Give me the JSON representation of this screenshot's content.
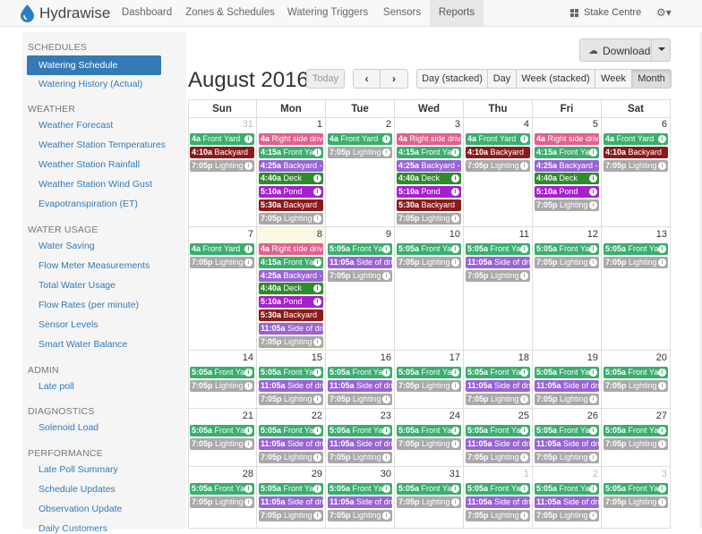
{
  "nav": {
    "brand": "Hydrawise",
    "items": [
      "Dashboard",
      "Zones & Schedules",
      "Watering Triggers",
      "Sensors",
      "Reports"
    ],
    "active": "Reports",
    "site": "Stake Centre",
    "settings_caret": "▾"
  },
  "sidebar": {
    "sections": [
      {
        "title": "SCHEDULES",
        "items": [
          "Watering Schedule",
          "Watering History (Actual)"
        ]
      },
      {
        "title": "WEATHER",
        "items": [
          "Weather Forecast",
          "Weather Station Temperatures",
          "Weather Station Rainfall",
          "Weather Station Wind Gust",
          "Evapotranspiration (ET)"
        ]
      },
      {
        "title": "WATER USAGE",
        "items": [
          "Water Saving",
          "Flow Meter Measurements",
          "Total Water Usage",
          "Flow Rates (per minute)",
          "Sensor Levels",
          "Smart Water Balance"
        ]
      },
      {
        "title": "ADMIN",
        "items": [
          "Late poll"
        ]
      },
      {
        "title": "DIAGNOSTICS",
        "items": [
          "Solenoid Load"
        ]
      },
      {
        "title": "PERFORMANCE",
        "items": [
          "Late Poll Summary",
          "Schedule Updates",
          "Observation Update",
          "Daily Customers"
        ]
      }
    ],
    "active_item": "Watering Schedule"
  },
  "toolbar": {
    "download": "Download",
    "month_title": "August 2016",
    "today": "Today",
    "prev": "‹",
    "next": "›",
    "views": [
      "Day (stacked)",
      "Day",
      "Week (stacked)",
      "Week",
      "Month"
    ],
    "active_view": "Month"
  },
  "colors": {
    "green": "#3aae6e",
    "pink": "#e0608f",
    "purple": "#9a63d6",
    "maroon": "#8b1a1a",
    "darkgreen": "#2e8b2e",
    "magenta": "#a620cf",
    "gray": "#a9a9a9"
  },
  "calendar": {
    "weekdays": [
      "Sun",
      "Mon",
      "Tue",
      "Wed",
      "Thu",
      "Fri",
      "Sat"
    ],
    "weeks": [
      [
        {
          "day": "31",
          "other": true,
          "events": [
            {
              "t": "4a",
              "n": "Front Yard",
              "c": "green",
              "i": true
            },
            {
              "t": "4:10a",
              "n": "Backyard",
              "c": "maroon"
            },
            {
              "t": "7:05p",
              "n": "Lighting",
              "c": "gray",
              "i": true
            }
          ]
        },
        {
          "day": "1",
          "events": [
            {
              "t": "4a",
              "n": "Right side driveway",
              "c": "pink"
            },
            {
              "t": "4:15a",
              "n": "Front Yard",
              "c": "green",
              "i": true
            },
            {
              "t": "4:25a",
              "n": "Backyard - Lawn",
              "c": "purple"
            },
            {
              "t": "4:40a",
              "n": "Deck",
              "c": "darkgreen",
              "i": true
            },
            {
              "t": "5:10a",
              "n": "Pond",
              "c": "magenta",
              "i": true
            },
            {
              "t": "5:30a",
              "n": "Backyard",
              "c": "maroon"
            },
            {
              "t": "7:05p",
              "n": "Lighting",
              "c": "gray",
              "i": true
            }
          ]
        },
        {
          "day": "2",
          "events": [
            {
              "t": "4a",
              "n": "Front Yard",
              "c": "green",
              "i": true
            },
            {
              "t": "7:05p",
              "n": "Lighting",
              "c": "gray",
              "i": true
            }
          ]
        },
        {
          "day": "3",
          "events": [
            {
              "t": "4a",
              "n": "Right side driveway",
              "c": "pink"
            },
            {
              "t": "4:15a",
              "n": "Front Yard",
              "c": "green",
              "i": true
            },
            {
              "t": "4:25a",
              "n": "Backyard - Lawn",
              "c": "purple"
            },
            {
              "t": "4:40a",
              "n": "Deck",
              "c": "darkgreen",
              "i": true
            },
            {
              "t": "5:10a",
              "n": "Pond",
              "c": "magenta",
              "i": true
            },
            {
              "t": "5:30a",
              "n": "Backyard",
              "c": "maroon"
            },
            {
              "t": "7:05p",
              "n": "Lighting",
              "c": "gray",
              "i": true
            }
          ]
        },
        {
          "day": "4",
          "events": [
            {
              "t": "4a",
              "n": "Front Yard",
              "c": "green",
              "i": true
            },
            {
              "t": "4:10a",
              "n": "Backyard",
              "c": "maroon"
            },
            {
              "t": "7:05p",
              "n": "Lighting",
              "c": "gray",
              "i": true
            }
          ]
        },
        {
          "day": "5",
          "events": [
            {
              "t": "4a",
              "n": "Right side driveway",
              "c": "pink"
            },
            {
              "t": "4:15a",
              "n": "Front Yard",
              "c": "green",
              "i": true
            },
            {
              "t": "4:25a",
              "n": "Backyard - Lawn",
              "c": "purple"
            },
            {
              "t": "4:40a",
              "n": "Deck",
              "c": "darkgreen",
              "i": true
            },
            {
              "t": "5:10a",
              "n": "Pond",
              "c": "magenta",
              "i": true
            },
            {
              "t": "7:05p",
              "n": "Lighting",
              "c": "gray",
              "i": true
            }
          ]
        },
        {
          "day": "6",
          "events": [
            {
              "t": "4a",
              "n": "Front Yard",
              "c": "green",
              "i": true
            },
            {
              "t": "4:10a",
              "n": "Backyard",
              "c": "maroon"
            },
            {
              "t": "7:05p",
              "n": "Lighting",
              "c": "gray",
              "i": true
            }
          ]
        }
      ],
      [
        {
          "day": "7",
          "events": [
            {
              "t": "4a",
              "n": "Front Yard",
              "c": "green",
              "i": true
            },
            {
              "t": "7:05p",
              "n": "Lighting",
              "c": "gray",
              "i": true
            }
          ]
        },
        {
          "day": "8",
          "today": true,
          "events": [
            {
              "t": "4a",
              "n": "Right side driveway",
              "c": "pink"
            },
            {
              "t": "4:15a",
              "n": "Front Yard",
              "c": "green",
              "i": true
            },
            {
              "t": "4:25a",
              "n": "Backyard - Lawn",
              "c": "purple"
            },
            {
              "t": "4:40a",
              "n": "Deck",
              "c": "darkgreen",
              "i": true
            },
            {
              "t": "5:10a",
              "n": "Pond",
              "c": "magenta",
              "i": true
            },
            {
              "t": "5:30a",
              "n": "Backyard",
              "c": "maroon"
            },
            {
              "t": "11:05a",
              "n": "Side of driveway",
              "c": "purple"
            },
            {
              "t": "7:05p",
              "n": "Lighting",
              "c": "gray",
              "i": true
            }
          ]
        },
        {
          "day": "9",
          "events": [
            {
              "t": "5:05a",
              "n": "Front Yard",
              "c": "green",
              "i": true
            },
            {
              "t": "11:05a",
              "n": "Side of driveway",
              "c": "purple"
            },
            {
              "t": "7:05p",
              "n": "Lighting",
              "c": "gray",
              "i": true
            }
          ]
        },
        {
          "day": "10",
          "events": [
            {
              "t": "5:05a",
              "n": "Front Yard",
              "c": "green",
              "i": true
            },
            {
              "t": "7:05p",
              "n": "Lighting",
              "c": "gray",
              "i": true
            }
          ]
        },
        {
          "day": "11",
          "events": [
            {
              "t": "5:05a",
              "n": "Front Yard",
              "c": "green",
              "i": true
            },
            {
              "t": "11:05a",
              "n": "Side of driveway",
              "c": "purple"
            },
            {
              "t": "7:05p",
              "n": "Lighting",
              "c": "gray",
              "i": true
            }
          ]
        },
        {
          "day": "12",
          "events": [
            {
              "t": "5:05a",
              "n": "Front Yard",
              "c": "green",
              "i": true
            },
            {
              "t": "7:05p",
              "n": "Lighting",
              "c": "gray",
              "i": true
            }
          ]
        },
        {
          "day": "13",
          "events": [
            {
              "t": "5:05a",
              "n": "Front Yard",
              "c": "green",
              "i": true
            },
            {
              "t": "7:05p",
              "n": "Lighting",
              "c": "gray",
              "i": true
            }
          ]
        }
      ],
      [
        {
          "day": "14",
          "events": [
            {
              "t": "5:05a",
              "n": "Front Yard",
              "c": "green",
              "i": true
            },
            {
              "t": "7:05p",
              "n": "Lighting",
              "c": "gray",
              "i": true
            }
          ]
        },
        {
          "day": "15",
          "events": [
            {
              "t": "5:05a",
              "n": "Front Yard",
              "c": "green",
              "i": true
            },
            {
              "t": "11:05a",
              "n": "Side of driveway",
              "c": "purple"
            },
            {
              "t": "7:05p",
              "n": "Lighting",
              "c": "gray",
              "i": true
            }
          ]
        },
        {
          "day": "16",
          "events": [
            {
              "t": "5:05a",
              "n": "Front Yard",
              "c": "green",
              "i": true
            },
            {
              "t": "11:05a",
              "n": "Side of driveway",
              "c": "purple"
            },
            {
              "t": "7:05p",
              "n": "Lighting",
              "c": "gray",
              "i": true
            }
          ]
        },
        {
          "day": "17",
          "events": [
            {
              "t": "5:05a",
              "n": "Front Yard",
              "c": "green",
              "i": true
            },
            {
              "t": "7:05p",
              "n": "Lighting",
              "c": "gray",
              "i": true
            }
          ]
        },
        {
          "day": "18",
          "events": [
            {
              "t": "5:05a",
              "n": "Front Yard",
              "c": "green",
              "i": true
            },
            {
              "t": "11:05a",
              "n": "Side of driveway",
              "c": "purple"
            },
            {
              "t": "7:05p",
              "n": "Lighting",
              "c": "gray",
              "i": true
            }
          ]
        },
        {
          "day": "19",
          "events": [
            {
              "t": "5:05a",
              "n": "Front Yard",
              "c": "green",
              "i": true
            },
            {
              "t": "11:05a",
              "n": "Side of driveway",
              "c": "purple"
            },
            {
              "t": "7:05p",
              "n": "Lighting",
              "c": "gray",
              "i": true
            }
          ]
        },
        {
          "day": "20",
          "events": [
            {
              "t": "5:05a",
              "n": "Front Yard",
              "c": "green",
              "i": true
            },
            {
              "t": "7:05p",
              "n": "Lighting",
              "c": "gray",
              "i": true
            }
          ]
        }
      ],
      [
        {
          "day": "21",
          "events": [
            {
              "t": "5:05a",
              "n": "Front Yard",
              "c": "green",
              "i": true
            },
            {
              "t": "7:05p",
              "n": "Lighting",
              "c": "gray",
              "i": true
            }
          ]
        },
        {
          "day": "22",
          "events": [
            {
              "t": "5:05a",
              "n": "Front Yard",
              "c": "green",
              "i": true
            },
            {
              "t": "11:05a",
              "n": "Side of driveway",
              "c": "purple"
            },
            {
              "t": "7:05p",
              "n": "Lighting",
              "c": "gray",
              "i": true
            }
          ]
        },
        {
          "day": "23",
          "events": [
            {
              "t": "5:05a",
              "n": "Front Yard",
              "c": "green",
              "i": true
            },
            {
              "t": "11:05a",
              "n": "Side of driveway",
              "c": "purple"
            },
            {
              "t": "7:05p",
              "n": "Lighting",
              "c": "gray",
              "i": true
            }
          ]
        },
        {
          "day": "24",
          "events": [
            {
              "t": "5:05a",
              "n": "Front Yard",
              "c": "green",
              "i": true
            },
            {
              "t": "7:05p",
              "n": "Lighting",
              "c": "gray",
              "i": true
            }
          ]
        },
        {
          "day": "25",
          "events": [
            {
              "t": "5:05a",
              "n": "Front Yard",
              "c": "green",
              "i": true
            },
            {
              "t": "11:05a",
              "n": "Side of driveway",
              "c": "purple"
            },
            {
              "t": "7:05p",
              "n": "Lighting",
              "c": "gray",
              "i": true
            }
          ]
        },
        {
          "day": "26",
          "events": [
            {
              "t": "5:05a",
              "n": "Front Yard",
              "c": "green",
              "i": true
            },
            {
              "t": "11:05a",
              "n": "Side of driveway",
              "c": "purple"
            },
            {
              "t": "7:05p",
              "n": "Lighting",
              "c": "gray",
              "i": true
            }
          ]
        },
        {
          "day": "27",
          "events": [
            {
              "t": "5:05a",
              "n": "Front Yard",
              "c": "green",
              "i": true
            },
            {
              "t": "7:05p",
              "n": "Lighting",
              "c": "gray",
              "i": true
            }
          ]
        }
      ],
      [
        {
          "day": "28",
          "events": [
            {
              "t": "5:05a",
              "n": "Front Yard",
              "c": "green",
              "i": true
            },
            {
              "t": "7:05p",
              "n": "Lighting",
              "c": "gray",
              "i": true
            }
          ]
        },
        {
          "day": "29",
          "events": [
            {
              "t": "5:05a",
              "n": "Front Yard",
              "c": "green",
              "i": true
            },
            {
              "t": "11:05a",
              "n": "Side of driveway",
              "c": "purple"
            },
            {
              "t": "7:05p",
              "n": "Lighting",
              "c": "gray",
              "i": true
            }
          ]
        },
        {
          "day": "30",
          "events": [
            {
              "t": "5:05a",
              "n": "Front Yard",
              "c": "green",
              "i": true
            },
            {
              "t": "11:05a",
              "n": "Side of driveway",
              "c": "purple"
            },
            {
              "t": "7:05p",
              "n": "Lighting",
              "c": "gray",
              "i": true
            }
          ]
        },
        {
          "day": "31",
          "events": [
            {
              "t": "5:05a",
              "n": "Front Yard",
              "c": "green",
              "i": true
            },
            {
              "t": "7:05p",
              "n": "Lighting",
              "c": "gray",
              "i": true
            }
          ]
        },
        {
          "day": "1",
          "other": true,
          "events": [
            {
              "t": "5:05a",
              "n": "Front Yard",
              "c": "green",
              "i": true
            },
            {
              "t": "11:05a",
              "n": "Side of driveway",
              "c": "purple"
            },
            {
              "t": "7:05p",
              "n": "Lighting",
              "c": "gray",
              "i": true
            }
          ]
        },
        {
          "day": "2",
          "other": true,
          "events": [
            {
              "t": "5:05a",
              "n": "Front Yard",
              "c": "green",
              "i": true
            },
            {
              "t": "11:05a",
              "n": "Side of driveway",
              "c": "purple"
            },
            {
              "t": "7:05p",
              "n": "Lighting",
              "c": "gray",
              "i": true
            }
          ]
        },
        {
          "day": "3",
          "other": true,
          "events": [
            {
              "t": "5:05a",
              "n": "Front Yard",
              "c": "green",
              "i": true
            },
            {
              "t": "7:05p",
              "n": "Lighting",
              "c": "gray",
              "i": true
            }
          ]
        }
      ]
    ]
  }
}
